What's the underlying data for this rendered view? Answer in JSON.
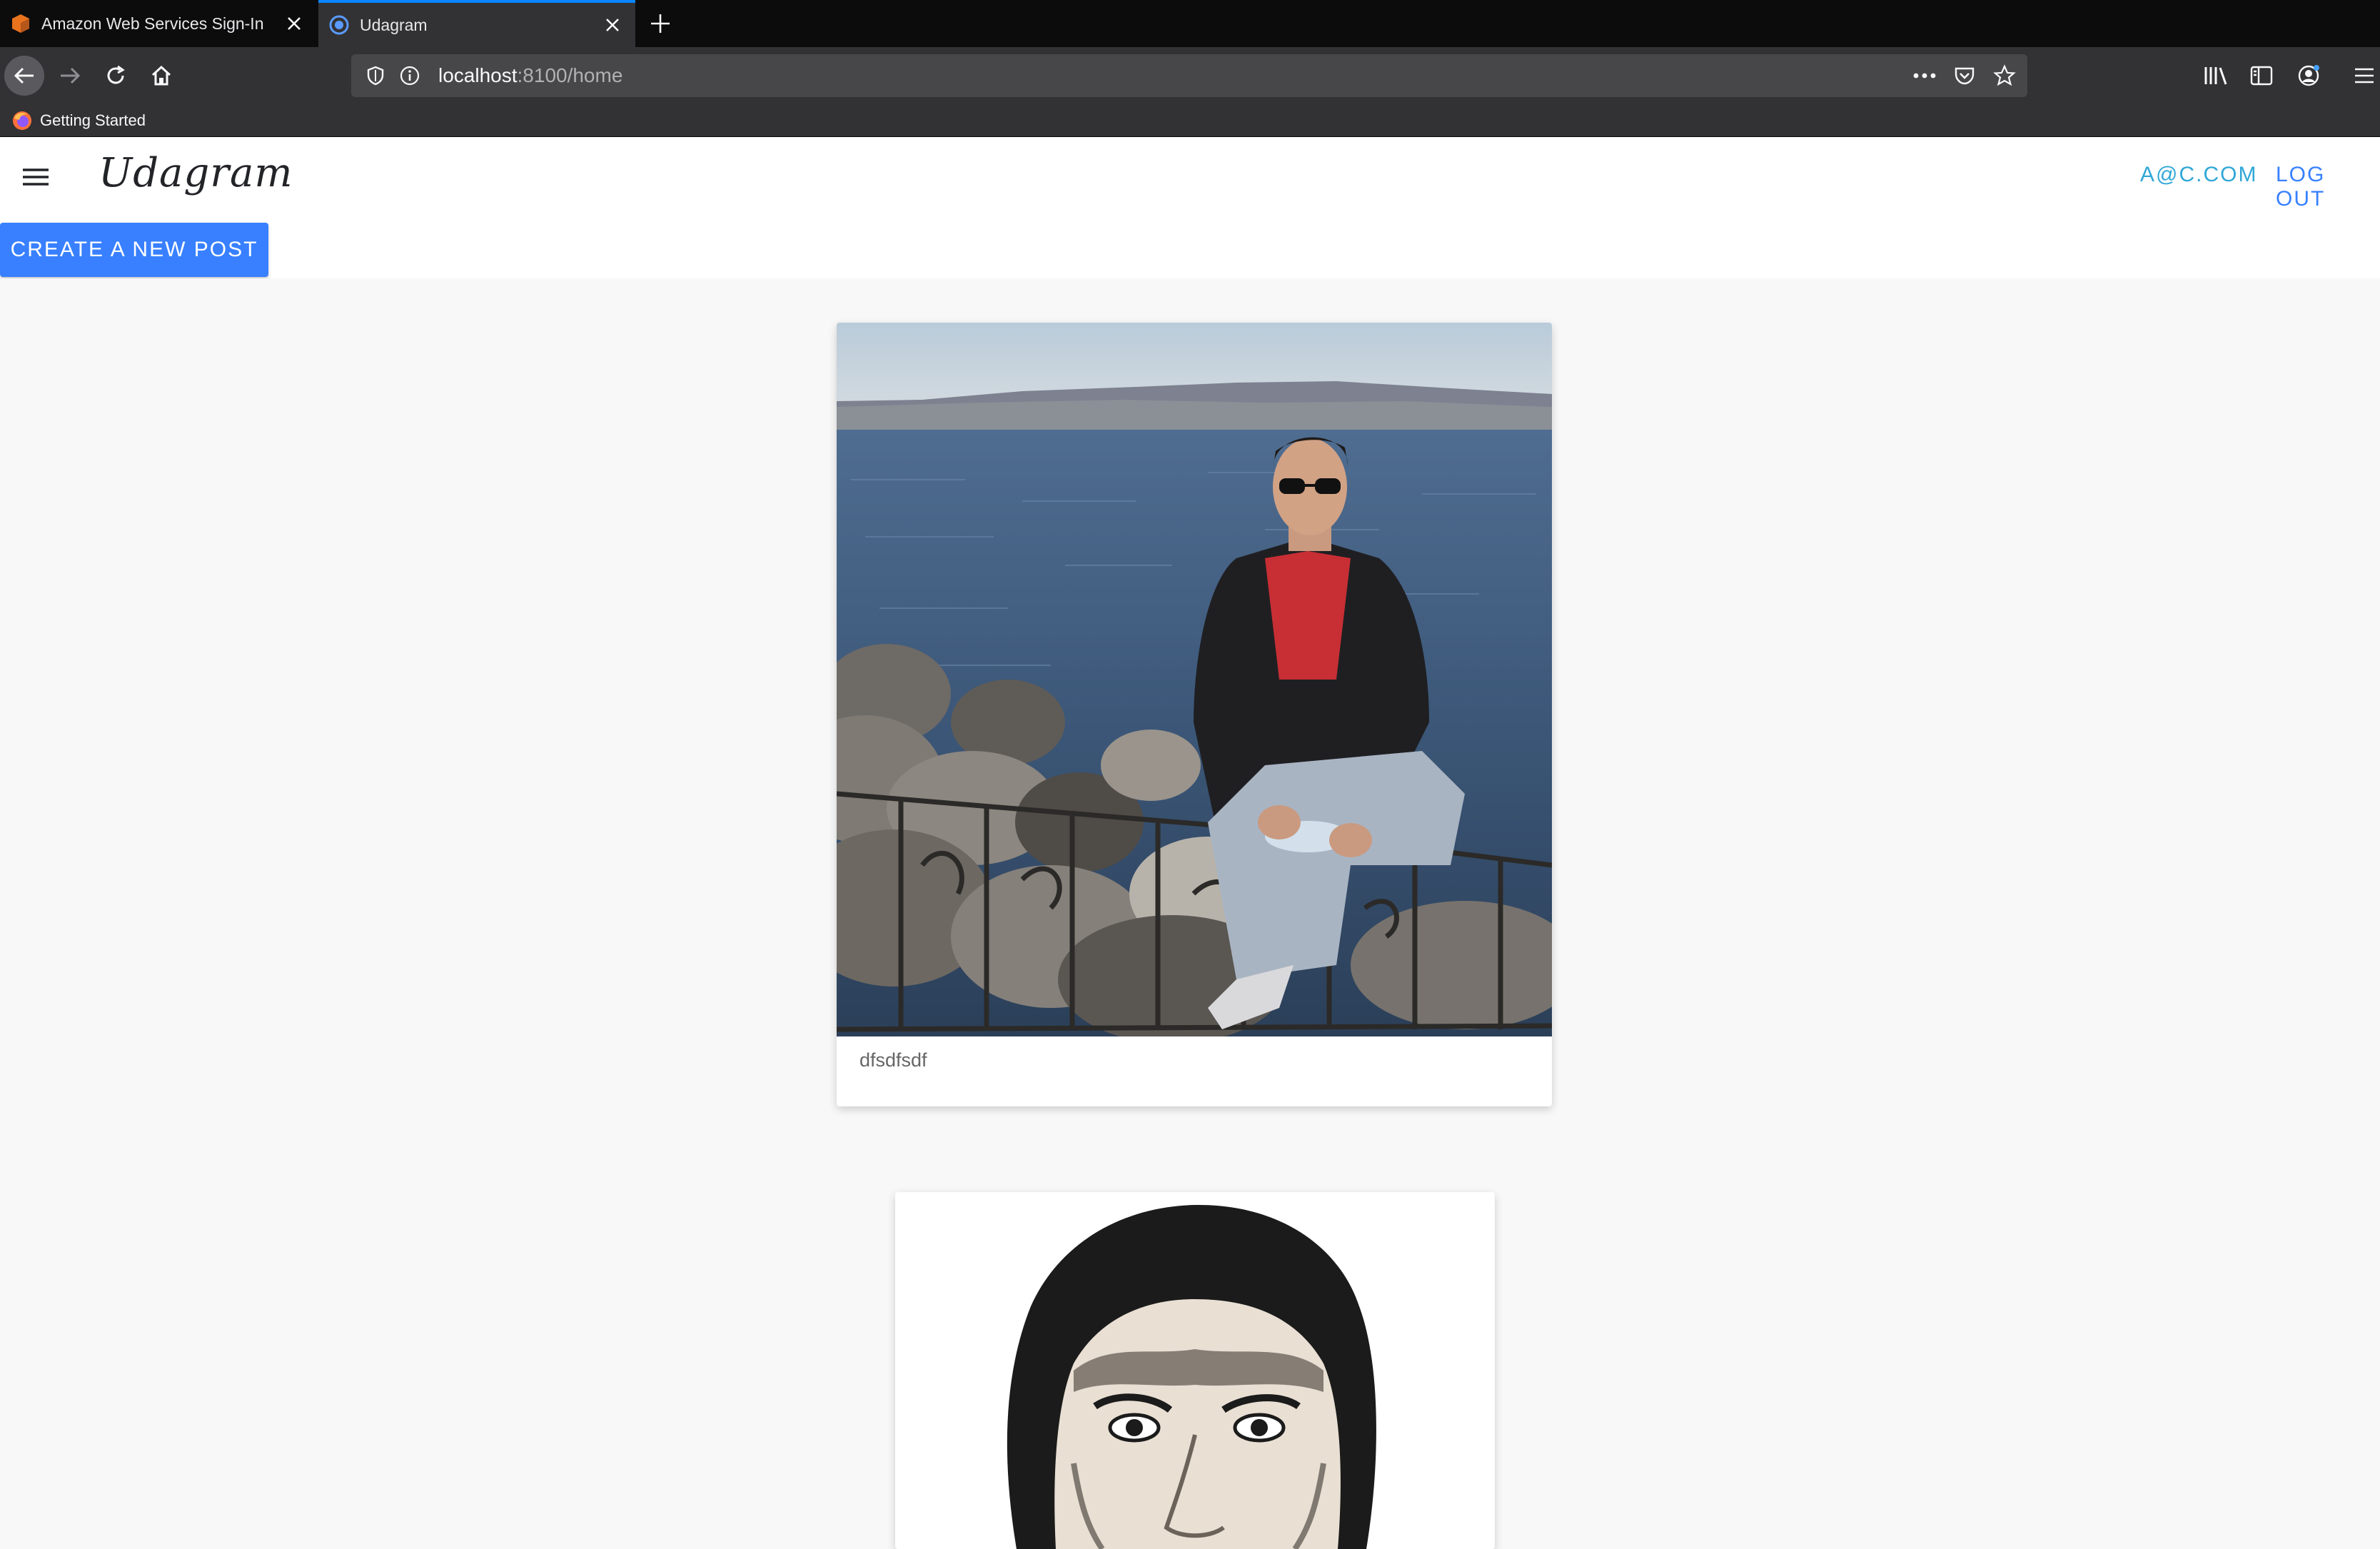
{
  "browser": {
    "tabs": [
      {
        "title": "Amazon Web Services Sign-In",
        "active": false,
        "favicon": "aws-box-icon"
      },
      {
        "title": "Udagram",
        "active": true,
        "favicon": "globe-icon"
      }
    ],
    "url_host": "localhost",
    "url_rest": ":8100/home",
    "bookmarks": [
      {
        "label": "Getting Started",
        "icon": "firefox-icon"
      }
    ]
  },
  "app": {
    "brand": "Udagram",
    "user_email": "A@C.COM",
    "logout_label": "LOG OUT",
    "create_post_label": "CREATE A NEW POST",
    "accent_color": "#3880ff",
    "user_link_color": "#2fa7d6"
  },
  "feed": {
    "posts": [
      {
        "caption": "dfsdfsdf",
        "image_subject": "man-sitting-by-sea-photo"
      },
      {
        "caption": "",
        "image_subject": "man-portrait-photo"
      }
    ]
  }
}
